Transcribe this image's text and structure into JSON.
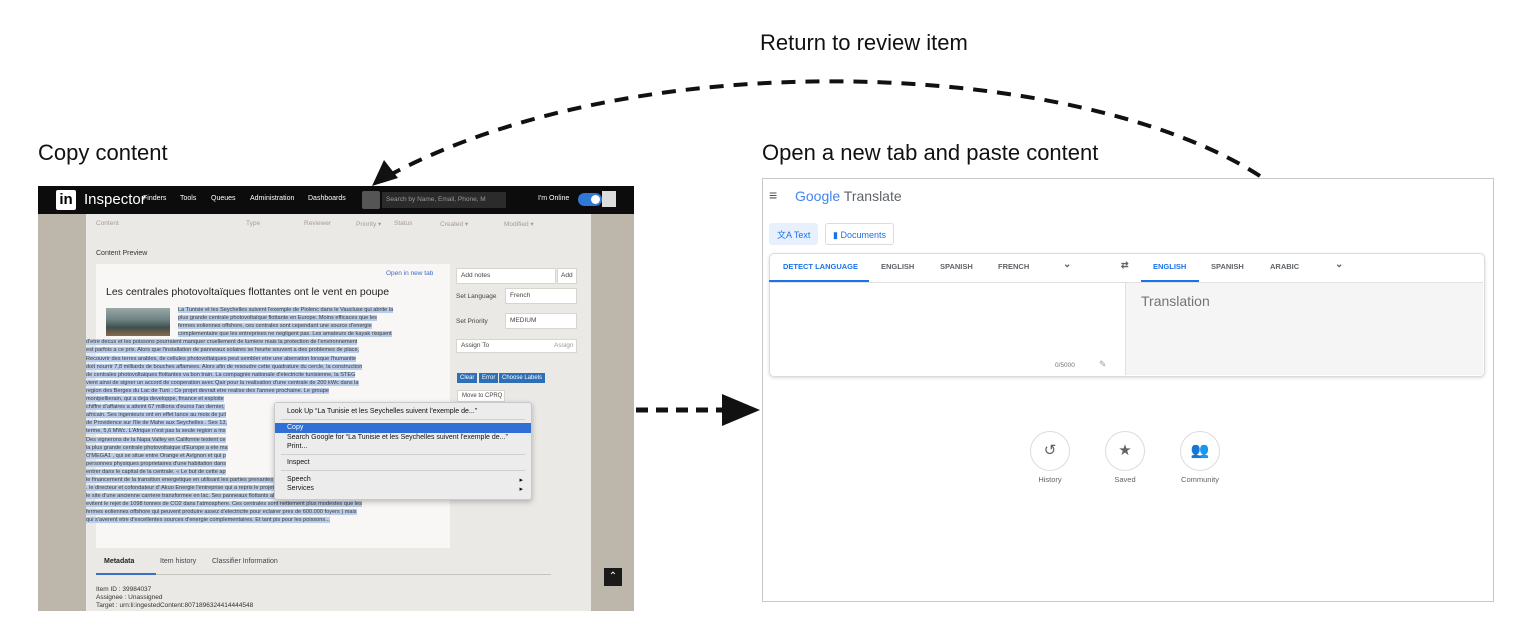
{
  "labels": {
    "return": "Return to review item",
    "copy": "Copy content",
    "open": "Open a new tab and paste content"
  },
  "inspector": {
    "logo": "in",
    "app_name": "Inspector",
    "nav": [
      "Finders",
      "Tools",
      "Queues",
      "Administration",
      "Dashboards"
    ],
    "search_placeholder": "Search by Name, Email, Phone, M",
    "online_label": "I'm Online",
    "columns": [
      "Content",
      "Type",
      "Reviewer",
      "Priority ▾",
      "Status",
      "Created ▾",
      "Modified ▾"
    ],
    "preview_title": "Content Preview",
    "open_new_tab": "Open in new tab",
    "headline": "Les centrales photovoltaïques flottantes ont le vent en poupe",
    "body_lines": [
      "La Tunisie et les Seychelles suivent l'exemple de Piolenc dans le Vaucluse qui abrite la",
      "plus grande centrale photovoltaïque flottante en Europe. Moins efficaces que les",
      "fermes eoliennes offshore, ces centrales sont cependant une source d'energie",
      "complementaire que les entreprises ne negligent pas. Les amateurs de kayak risquent",
      "d'etre decus et les poissons pourraient manquer cruellement de lumiere mais la protection de l'environnement",
      "est parfois a ce prix. Alors que l'installation de panneaux solaires se heurte souvent a des problemes de place,",
      "Recouvrir des terres arables, de cellules photovoltaiques peut sembler etre une aberration lorsque l'humanite",
      "doit nourrir 7,8 milliards de bouches affamees. Alors afin de resoudre cette quadrature du cercle, la construction",
      "de centrales photovoltaiques flottantes va bon train. La compagnie nationale d'electricite tunisienne, la STEG",
      "vient ainsi de signer un accord de cooperation avec Qair pour la realisation d'une centrale de 200 kWc dans la",
      "region des Berges du Lac de Tuni . Ce projet devrait etre realise des l'annee prochaine. Le groupe",
      "montpellierain, qui a deja developpe, finance et exploite",
      "chiffre d'affaires a atteint 67 millions d'euros l'an dernier,",
      "africain. Ses ingenieurs ont en effet lance au mois de juil",
      "de Providence sur l'Ile de Mahe aux Seychelles . Ses 13,",
      "terme, 5,6 MWc. L'Afrique n'est pas la seule region a ins",
      "Des vignerons de la Napa Valley en Californie testent ce",
      "la plus grande centrale photovoltaique d'Europe a ete ma",
      "O'MEGA1 , qui se situe entre Orange et Avignon et qui p",
      "personnes physiques proprietaires d'une habitation dans",
      "entrer dans le capital de la centrale. « Le but de cette ap",
      "le financement de la transition energetique en utilisant les parties prenantes de la region », explique a l'AFP",
      ". le directeur et cofondateur d' Akuo Energie l'entreprise qui a repris le projet. O'MEGA1 a ete lance en 2014 sur",
      "le site d'une ancienne carriere transformee en lac. Ses panneaux flottants alimentent aujourd'hui 4733 foyers et",
      "evitent le rejet de 1098 tonnes de CO2 dans l'atmosphere. Ces centrales sont nettement plus modestes que les",
      "fermes eoliennes offshore qui peuvent produire assez d'electricite pour eclairer pres de 600.000 foyers ) mais",
      "qui s'averent etre d'excellentes sources d'energie complementaires. Et tant pis pour les poissons..."
    ],
    "add_notes_placeholder": "Add notes",
    "add_btn": "Add",
    "set_language_label": "Set Language",
    "language_value": "French",
    "set_priority_label": "Set Priority",
    "priority_value": "MEDIUM",
    "assign_to_label": "Assign To",
    "assign_btn": "Assign",
    "action_buttons": [
      "Clear",
      "Error",
      "Choose Labels"
    ],
    "move_btn": "Move to CPRQ",
    "context_menu": {
      "lookup": "Look Up “La Tunisie et les Seychelles suivent l'exemple de...”",
      "copy": "Copy",
      "search": "Search Google for “La Tunisie et les Seychelles suivent l'exemple de...”",
      "print": "Print...",
      "inspect": "Inspect",
      "speech": "Speech",
      "services": "Services"
    },
    "tabs": [
      "Metadata",
      "Item history",
      "Classifier Information"
    ],
    "meta_lines": [
      "Item ID : 39984037",
      "Assignee : Unassigned",
      "Target : urn:li:ingestedContent:8071896324414444548"
    ]
  },
  "translate": {
    "brand": "Google",
    "product": "Translate",
    "mode_text": "Text",
    "mode_docs": "Documents",
    "source_langs": [
      "DETECT LANGUAGE",
      "ENGLISH",
      "SPANISH",
      "FRENCH"
    ],
    "target_langs": [
      "ENGLISH",
      "SPANISH",
      "ARABIC"
    ],
    "translation_placeholder": "Translation",
    "char_count": "0/5000",
    "actions": [
      "History",
      "Saved",
      "Community"
    ]
  }
}
